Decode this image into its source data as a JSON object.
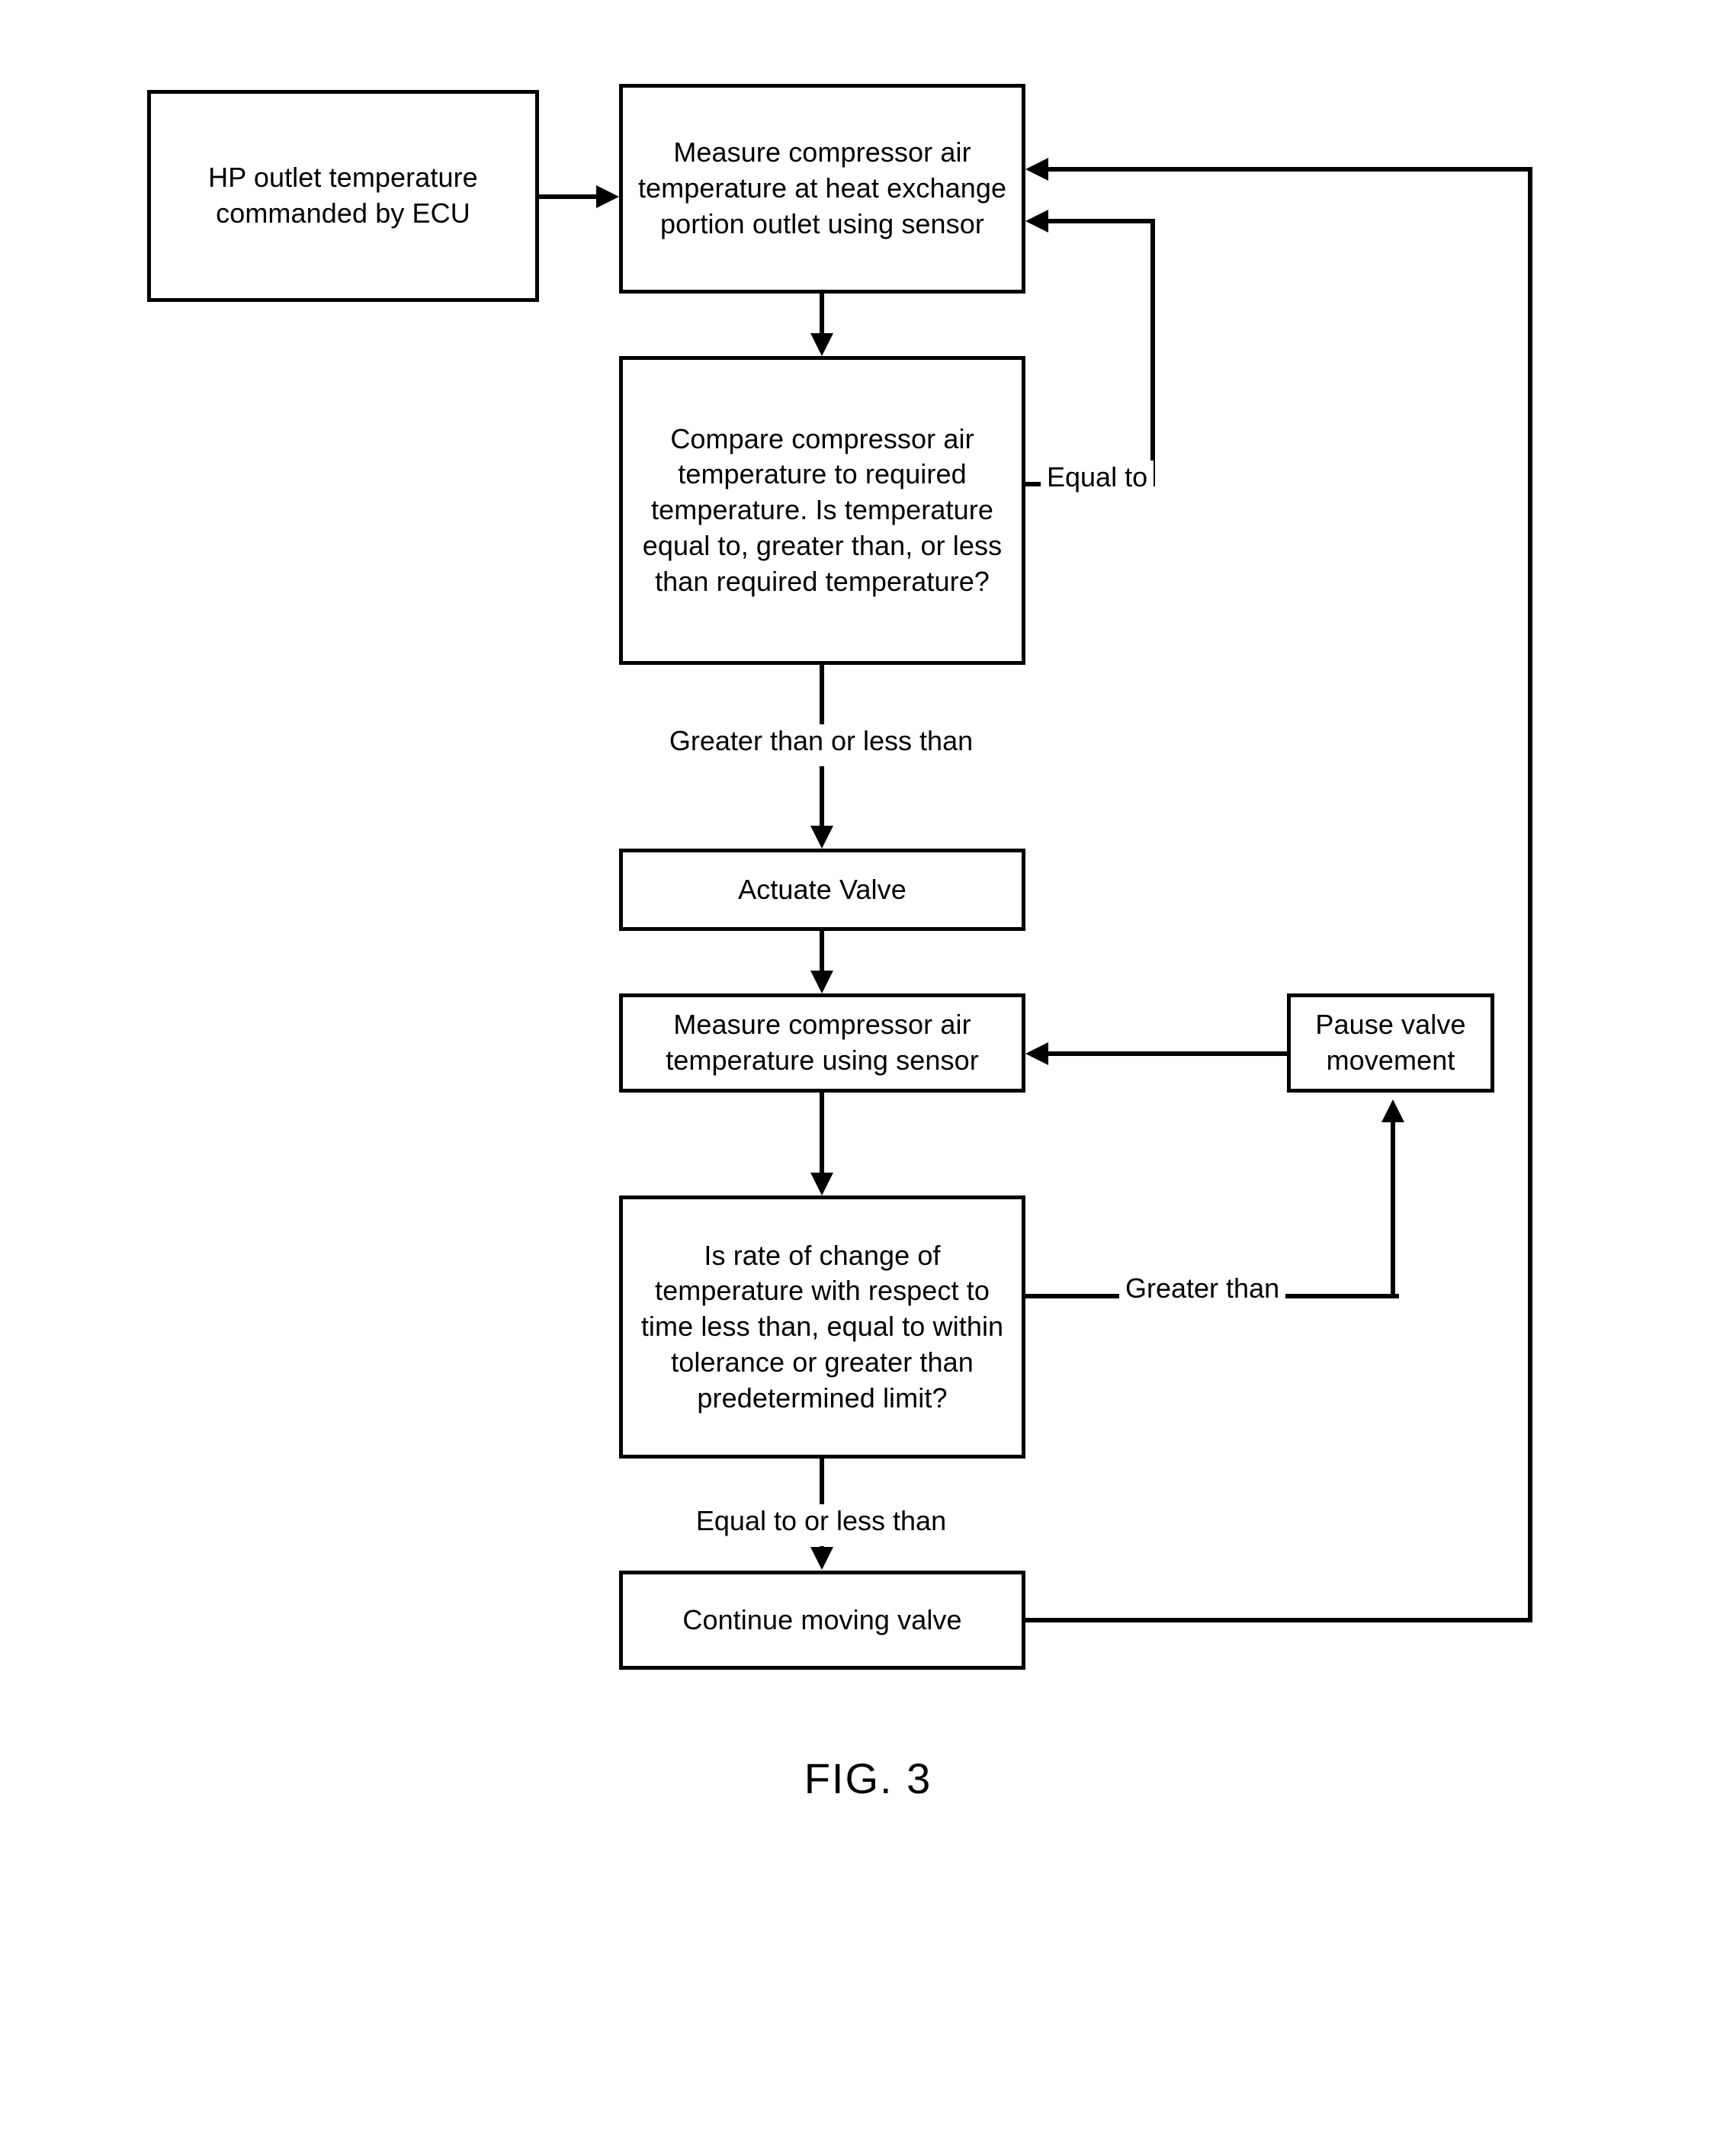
{
  "figure": {
    "caption": "FIG. 3",
    "type": "process-flowchart"
  },
  "nodes": {
    "hp_outlet": "HP outlet temperature commanded by ECU",
    "measure_hx_outlet": "Measure compressor air temperature at heat exchange portion outlet using sensor",
    "compare_temp": "Compare compressor air temperature to required temperature. Is temperature equal to, greater than, or less than required temperature?",
    "actuate_valve": "Actuate Valve",
    "measure_sensor": "Measure compressor air temperature using sensor",
    "rate_of_change": "Is rate of change of temperature with respect to time less than, equal to within tolerance or greater than predetermined limit?",
    "pause_valve": "Pause valve movement",
    "continue_valve": "Continue moving valve"
  },
  "edge_labels": {
    "equal_to": "Equal to",
    "greater_or_less": "Greater than or less than",
    "greater_than": "Greater than",
    "equal_or_less": "Equal to or less than"
  },
  "chart_data": {
    "type": "table",
    "title": "FIG. 3",
    "nodes": [
      {
        "id": "hp_outlet",
        "label": "HP outlet temperature commanded by ECU",
        "shape": "rectangle"
      },
      {
        "id": "measure_hx_outlet",
        "label": "Measure compressor air temperature at heat exchange portion outlet using sensor",
        "shape": "rectangle"
      },
      {
        "id": "compare_temp",
        "label": "Compare compressor air temperature to required temperature. Is temperature equal to, greater than, or less than required temperature?",
        "shape": "rectangle"
      },
      {
        "id": "actuate_valve",
        "label": "Actuate Valve",
        "shape": "rectangle"
      },
      {
        "id": "measure_sensor",
        "label": "Measure compressor air temperature using sensor",
        "shape": "rectangle"
      },
      {
        "id": "rate_of_change",
        "label": "Is rate of change of temperature with respect to time less than, equal to within tolerance or greater than predetermined limit?",
        "shape": "rectangle"
      },
      {
        "id": "pause_valve",
        "label": "Pause valve movement",
        "shape": "rectangle"
      },
      {
        "id": "continue_valve",
        "label": "Continue moving valve",
        "shape": "rectangle"
      }
    ],
    "edges": [
      {
        "from": "hp_outlet",
        "to": "measure_hx_outlet",
        "label": ""
      },
      {
        "from": "measure_hx_outlet",
        "to": "compare_temp",
        "label": ""
      },
      {
        "from": "compare_temp",
        "to": "measure_hx_outlet",
        "label": "Equal to"
      },
      {
        "from": "compare_temp",
        "to": "actuate_valve",
        "label": "Greater than or less than"
      },
      {
        "from": "actuate_valve",
        "to": "measure_sensor",
        "label": ""
      },
      {
        "from": "measure_sensor",
        "to": "rate_of_change",
        "label": ""
      },
      {
        "from": "rate_of_change",
        "to": "pause_valve",
        "label": "Greater than"
      },
      {
        "from": "pause_valve",
        "to": "measure_sensor",
        "label": ""
      },
      {
        "from": "rate_of_change",
        "to": "continue_valve",
        "label": "Equal to or less than"
      },
      {
        "from": "continue_valve",
        "to": "measure_hx_outlet",
        "label": ""
      }
    ]
  }
}
